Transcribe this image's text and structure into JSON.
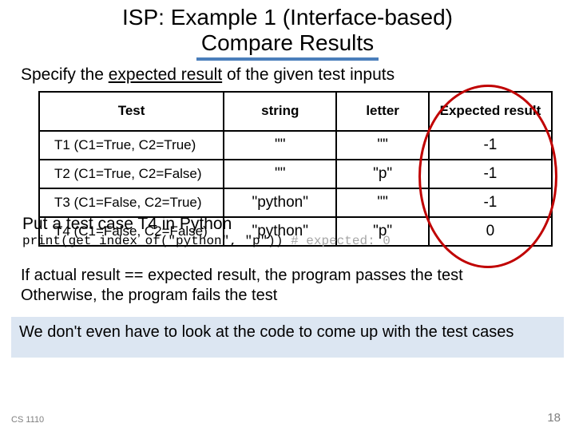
{
  "title": {
    "line1": "ISP: Example 1 (Interface-based)",
    "line2": "Compare Results"
  },
  "subtitle": {
    "pre": "Specify the ",
    "ul": "expected result",
    "post": " of the given test inputs"
  },
  "table": {
    "headers": {
      "test": "Test",
      "string": "string",
      "letter": "letter",
      "expected": "Expected result"
    },
    "rows": [
      {
        "name": "T1 (C1=True, C2=True)",
        "string": "\"\"",
        "letter": "\"\"",
        "expected": "-1"
      },
      {
        "name": "T2 (C1=True, C2=False)",
        "string": "\"\"",
        "letter": "\"p\"",
        "expected": "-1"
      },
      {
        "name": "T3 (C1=False, C2=True)",
        "string": "\"python\"",
        "letter": "\"\"",
        "expected": "-1"
      },
      {
        "name": "T4 (C1=False, C2=False)",
        "string": "\"python\"",
        "letter": "\"p\"",
        "expected": "0"
      }
    ]
  },
  "overlay": {
    "put": "Put a test case T4 in Python",
    "code_pre": "print(get_index_of(\"python\", \"p\"))  ",
    "code_comment": "# expected: 0"
  },
  "body": {
    "l1": "If actual result == expected result, the program passes the test",
    "l2": "Otherwise, the program fails the test"
  },
  "banner": "We don't even have to look at the code to come up with the test cases",
  "footer": {
    "left": "CS 1110",
    "right": "18"
  }
}
